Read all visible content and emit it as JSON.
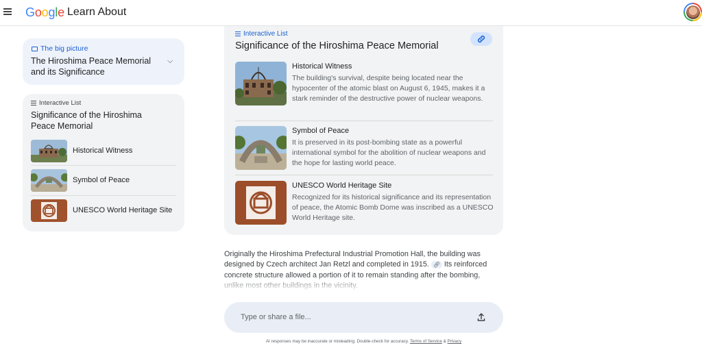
{
  "header": {
    "logo": "Google",
    "product": "Learn About"
  },
  "colors": {
    "accent": "#1a5fd0",
    "card_bg": "#f1f3f4",
    "bigpicture_bg": "#eef3fb",
    "input_bg": "#e9eef6"
  },
  "sidebar": {
    "big_picture": {
      "label": "The big picture",
      "title": "The Hiroshima Peace Memorial and its Significance"
    },
    "interactive_list": {
      "label": "Interactive List",
      "title": "Significance of the Hiroshima Peace Memorial",
      "items": [
        {
          "label": "Historical Witness",
          "icon": "dome-ruins-photo"
        },
        {
          "label": "Symbol of Peace",
          "icon": "cenotaph-photo"
        },
        {
          "label": "UNESCO World Heritage Site",
          "icon": "unesco-emblem"
        }
      ]
    }
  },
  "main": {
    "card": {
      "label": "Interactive List",
      "title": "Significance of the Hiroshima Peace Memorial",
      "link_icon": "link-icon",
      "items": [
        {
          "heading": "Historical Witness",
          "description": "The building's survival, despite being located near the hypocenter of the atomic blast on August 6, 1945, makes it a stark reminder of the destructive power of nuclear weapons."
        },
        {
          "heading": "Symbol of Peace",
          "description": "It is preserved in its post-bombing state as a powerful international symbol for the abolition of nuclear weapons and the hope for lasting world peace."
        },
        {
          "heading": "UNESCO World Heritage Site",
          "description": "Recognized for its historical significance and its representation of peace, the Atomic Bomb Dome was inscribed as a UNESCO World Heritage site."
        }
      ]
    },
    "paragraph": {
      "part1": "Originally the Hiroshima Prefectural Industrial Promotion Hall, the building was designed by Czech architect Jan Retzl and completed in 1915.",
      "part2": "Its reinforced concrete structure allowed a portion of it to remain standing after the bombing, unlike most other buildings in the vicinity."
    },
    "input": {
      "placeholder": "Type or share a file..."
    },
    "disclaimer": {
      "text": "AI responses may be inaccurate or misleading. Double-check for accuracy.",
      "terms": "Terms of Service",
      "amp": "&",
      "privacy": "Privacy"
    }
  }
}
